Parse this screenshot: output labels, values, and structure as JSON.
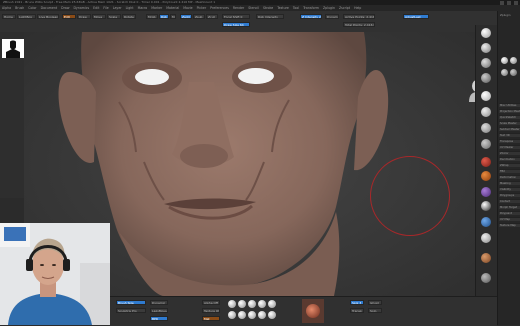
{
  "titlebar": {
    "title": "ZBrush 2021  -  Bruce Willis Sculpt  -  Free Mem 25.63GB  -  Active Mem 1021  -  Scratch Disk 0  -  Timer 0.001  -  PolyCount 2.416 MP  -  MeshCount 1"
  },
  "menubar": {
    "items": [
      "Alpha",
      "Brush",
      "Color",
      "Document",
      "Draw",
      "Dynamics",
      "Edit",
      "File",
      "Layer",
      "Light",
      "Macro",
      "Marker",
      "Material",
      "Movie",
      "Picker",
      "Preferences",
      "Render",
      "Stencil",
      "Stroke",
      "Texture",
      "Tool",
      "Transform",
      "Zplugin",
      "Zscript",
      "Help"
    ]
  },
  "top_shelf": {
    "controls": [
      "Home",
      "LightBox",
      "Live Boolean",
      "Edit",
      "Draw",
      "Move",
      "Scale",
      "Rotate",
      "Mrgb",
      "Rgb",
      "M",
      "Zadd",
      "Zsub",
      "Zcut",
      "Focal Shift 0",
      "Draw Size 64",
      "Rgb Intensity",
      "Z Intensity 25",
      "Dynamic",
      "Active Points: 2.416 Mil",
      "Total Points: 2.416 Mil",
      "AdjustLast"
    ]
  },
  "viewport": {
    "navigation_label": "Persp"
  },
  "right_tray": {
    "title": "Zplugin",
    "items": [
      "Misc Utilities",
      "Projection Master",
      "QuickSketch",
      "Scale Master",
      "Subtool Master",
      "Text 3D",
      "Transpose",
      "UV Master",
      "ZColor",
      "Decimation",
      "ZWrap",
      "FBX",
      "Deformation",
      "Masking",
      "Visibility",
      "Polygroups",
      "Contact",
      "Morph Target",
      "Polypaint",
      "UV Map",
      "Texture Map"
    ]
  },
  "bottom_shelf": {
    "controls": [
      "Brush Size",
      "Sculptris Pro",
      "Dynamic",
      "LazyMouse",
      "BPR",
      "Alpha Off",
      "Texture Off",
      "Mat",
      "Spix 3",
      "Transp",
      "Ghost",
      "Solo"
    ]
  },
  "colors": {
    "skin": "#8a6a5e",
    "background": "#3a3a3a",
    "ui_dark": "#2b2b2b",
    "accent_blue": "#2f7bd0",
    "brush_ring": "#a7282a"
  }
}
